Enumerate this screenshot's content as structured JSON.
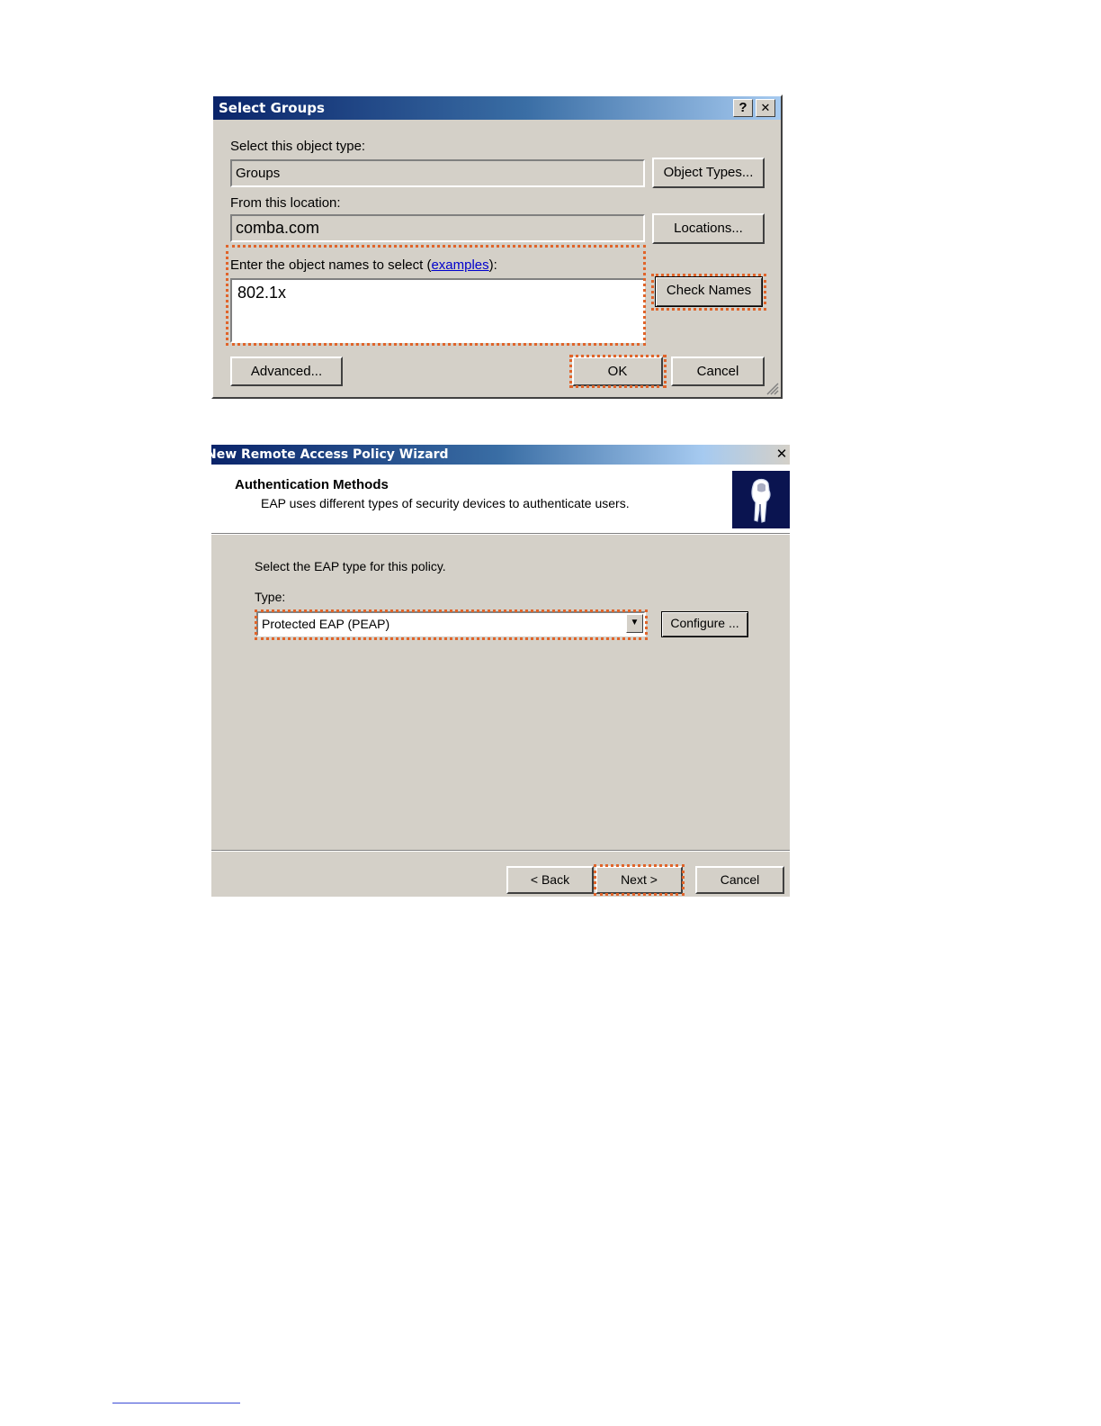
{
  "select_groups": {
    "title": "Select Groups",
    "help_button": "?",
    "close_button": "✕",
    "object_type_label": "Select this object type:",
    "object_type_value": "Groups",
    "object_types_button": "Object Types...",
    "location_label": "From this location:",
    "location_value": "comba.com",
    "locations_button": "Locations...",
    "names_label_prefix": "Enter the object names to select (",
    "names_label_link": "examples",
    "names_label_suffix": "):",
    "names_value": "802.1x",
    "check_names_button": "Check Names",
    "advanced_button": "Advanced...",
    "ok_button": "OK",
    "cancel_button": "Cancel"
  },
  "wizard": {
    "title": "New Remote Access Policy Wizard",
    "close_button": "✕",
    "heading": "Authentication Methods",
    "subheading": "EAP uses different types of security devices to authenticate users.",
    "instruction": "Select the EAP type for this policy.",
    "type_label": "Type:",
    "type_value": "Protected EAP (PEAP)",
    "configure_button": "Configure ...",
    "back_button": "< Back",
    "next_button": "Next >",
    "cancel_button": "Cancel"
  },
  "colors": {
    "highlight": "#e0642a",
    "title_start": "#0a246a",
    "title_end": "#a6caf0",
    "dialog_face": "#d4d0c8",
    "logo_bg": "#0a1450"
  }
}
